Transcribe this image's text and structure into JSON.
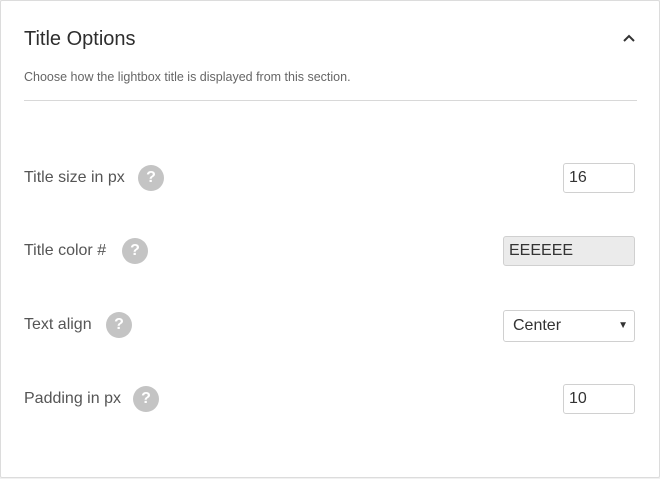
{
  "panel": {
    "title": "Title Options",
    "description": "Choose how the lightbox title is displayed from this section.",
    "collapse_icon": "chevron-up-icon"
  },
  "settings": {
    "title_size": {
      "label": "Title size in px",
      "value": "16",
      "help_icon": "?"
    },
    "title_color": {
      "label": "Title color #",
      "value": "EEEEEE",
      "help_icon": "?"
    },
    "text_align": {
      "label": "Text align",
      "selected": "Center",
      "help_icon": "?",
      "arrow": "▼"
    },
    "padding": {
      "label": "Padding in px",
      "value": "10",
      "help_icon": "?"
    }
  },
  "colors": {
    "help_icon_bg": "#c4c4c4",
    "color_input_bg": "#ebebeb",
    "divider": "#d8d8d8"
  }
}
